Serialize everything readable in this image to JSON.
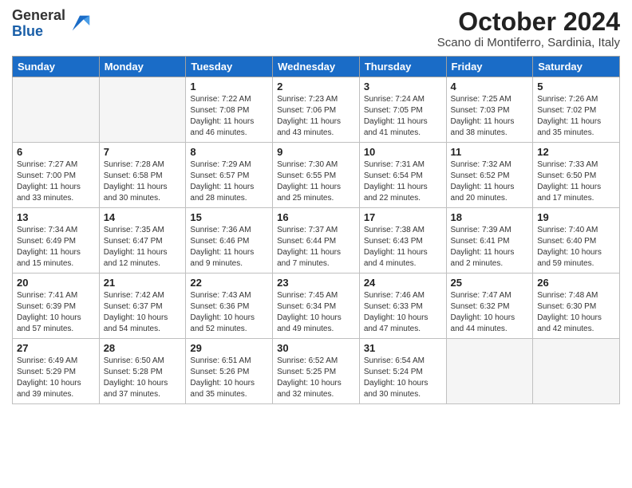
{
  "logo": {
    "general": "General",
    "blue": "Blue"
  },
  "header": {
    "month": "October 2024",
    "location": "Scano di Montiferro, Sardinia, Italy"
  },
  "days_of_week": [
    "Sunday",
    "Monday",
    "Tuesday",
    "Wednesday",
    "Thursday",
    "Friday",
    "Saturday"
  ],
  "weeks": [
    [
      {
        "day": "",
        "info": ""
      },
      {
        "day": "",
        "info": ""
      },
      {
        "day": "1",
        "info": "Sunrise: 7:22 AM\nSunset: 7:08 PM\nDaylight: 11 hours and 46 minutes."
      },
      {
        "day": "2",
        "info": "Sunrise: 7:23 AM\nSunset: 7:06 PM\nDaylight: 11 hours and 43 minutes."
      },
      {
        "day": "3",
        "info": "Sunrise: 7:24 AM\nSunset: 7:05 PM\nDaylight: 11 hours and 41 minutes."
      },
      {
        "day": "4",
        "info": "Sunrise: 7:25 AM\nSunset: 7:03 PM\nDaylight: 11 hours and 38 minutes."
      },
      {
        "day": "5",
        "info": "Sunrise: 7:26 AM\nSunset: 7:02 PM\nDaylight: 11 hours and 35 minutes."
      }
    ],
    [
      {
        "day": "6",
        "info": "Sunrise: 7:27 AM\nSunset: 7:00 PM\nDaylight: 11 hours and 33 minutes."
      },
      {
        "day": "7",
        "info": "Sunrise: 7:28 AM\nSunset: 6:58 PM\nDaylight: 11 hours and 30 minutes."
      },
      {
        "day": "8",
        "info": "Sunrise: 7:29 AM\nSunset: 6:57 PM\nDaylight: 11 hours and 28 minutes."
      },
      {
        "day": "9",
        "info": "Sunrise: 7:30 AM\nSunset: 6:55 PM\nDaylight: 11 hours and 25 minutes."
      },
      {
        "day": "10",
        "info": "Sunrise: 7:31 AM\nSunset: 6:54 PM\nDaylight: 11 hours and 22 minutes."
      },
      {
        "day": "11",
        "info": "Sunrise: 7:32 AM\nSunset: 6:52 PM\nDaylight: 11 hours and 20 minutes."
      },
      {
        "day": "12",
        "info": "Sunrise: 7:33 AM\nSunset: 6:50 PM\nDaylight: 11 hours and 17 minutes."
      }
    ],
    [
      {
        "day": "13",
        "info": "Sunrise: 7:34 AM\nSunset: 6:49 PM\nDaylight: 11 hours and 15 minutes."
      },
      {
        "day": "14",
        "info": "Sunrise: 7:35 AM\nSunset: 6:47 PM\nDaylight: 11 hours and 12 minutes."
      },
      {
        "day": "15",
        "info": "Sunrise: 7:36 AM\nSunset: 6:46 PM\nDaylight: 11 hours and 9 minutes."
      },
      {
        "day": "16",
        "info": "Sunrise: 7:37 AM\nSunset: 6:44 PM\nDaylight: 11 hours and 7 minutes."
      },
      {
        "day": "17",
        "info": "Sunrise: 7:38 AM\nSunset: 6:43 PM\nDaylight: 11 hours and 4 minutes."
      },
      {
        "day": "18",
        "info": "Sunrise: 7:39 AM\nSunset: 6:41 PM\nDaylight: 11 hours and 2 minutes."
      },
      {
        "day": "19",
        "info": "Sunrise: 7:40 AM\nSunset: 6:40 PM\nDaylight: 10 hours and 59 minutes."
      }
    ],
    [
      {
        "day": "20",
        "info": "Sunrise: 7:41 AM\nSunset: 6:39 PM\nDaylight: 10 hours and 57 minutes."
      },
      {
        "day": "21",
        "info": "Sunrise: 7:42 AM\nSunset: 6:37 PM\nDaylight: 10 hours and 54 minutes."
      },
      {
        "day": "22",
        "info": "Sunrise: 7:43 AM\nSunset: 6:36 PM\nDaylight: 10 hours and 52 minutes."
      },
      {
        "day": "23",
        "info": "Sunrise: 7:45 AM\nSunset: 6:34 PM\nDaylight: 10 hours and 49 minutes."
      },
      {
        "day": "24",
        "info": "Sunrise: 7:46 AM\nSunset: 6:33 PM\nDaylight: 10 hours and 47 minutes."
      },
      {
        "day": "25",
        "info": "Sunrise: 7:47 AM\nSunset: 6:32 PM\nDaylight: 10 hours and 44 minutes."
      },
      {
        "day": "26",
        "info": "Sunrise: 7:48 AM\nSunset: 6:30 PM\nDaylight: 10 hours and 42 minutes."
      }
    ],
    [
      {
        "day": "27",
        "info": "Sunrise: 6:49 AM\nSunset: 5:29 PM\nDaylight: 10 hours and 39 minutes."
      },
      {
        "day": "28",
        "info": "Sunrise: 6:50 AM\nSunset: 5:28 PM\nDaylight: 10 hours and 37 minutes."
      },
      {
        "day": "29",
        "info": "Sunrise: 6:51 AM\nSunset: 5:26 PM\nDaylight: 10 hours and 35 minutes."
      },
      {
        "day": "30",
        "info": "Sunrise: 6:52 AM\nSunset: 5:25 PM\nDaylight: 10 hours and 32 minutes."
      },
      {
        "day": "31",
        "info": "Sunrise: 6:54 AM\nSunset: 5:24 PM\nDaylight: 10 hours and 30 minutes."
      },
      {
        "day": "",
        "info": ""
      },
      {
        "day": "",
        "info": ""
      }
    ]
  ]
}
